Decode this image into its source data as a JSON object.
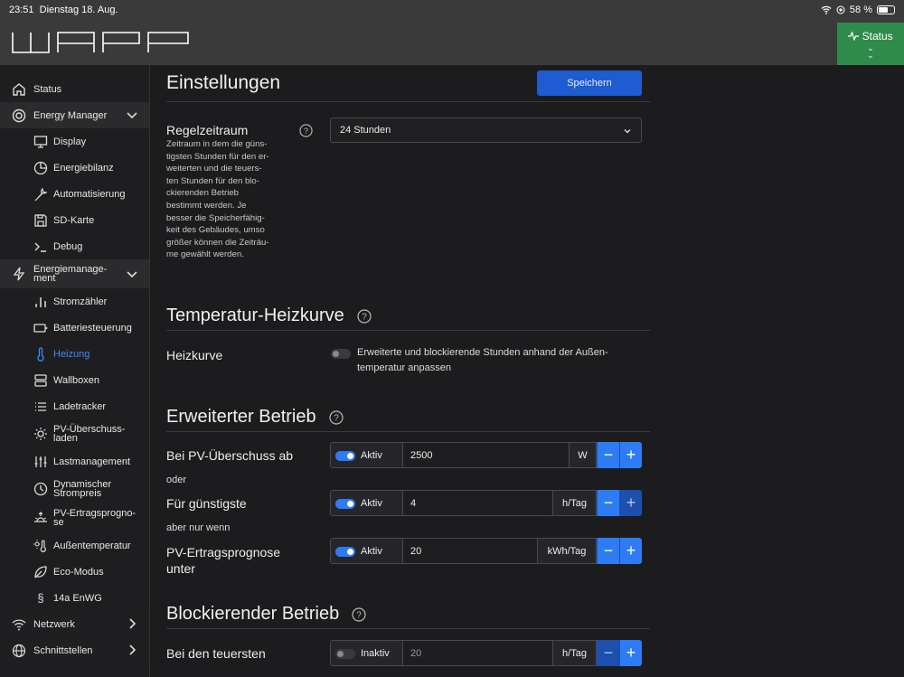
{
  "statusbar": {
    "time": "23:51",
    "date": "Dienstag 18. Aug.",
    "battery": "58 %"
  },
  "header": {
    "logo": "WARP",
    "status_label": "Status"
  },
  "sidebar": {
    "items": [
      {
        "label": "Status",
        "icon": "home-icon"
      },
      {
        "label": "Energy Manager",
        "icon": "energy-manager-icon"
      },
      {
        "label": "Display",
        "icon": "monitor-icon"
      },
      {
        "label": "Energiebilanz",
        "icon": "pie-chart-icon"
      },
      {
        "label": "Automatisierung",
        "icon": "wrench-icon"
      },
      {
        "label": "SD-Karte",
        "icon": "save-icon"
      },
      {
        "label": "Debug",
        "icon": "terminal-icon"
      },
      {
        "label": "Energiemanage-\nment",
        "icon": "lightning-icon"
      },
      {
        "label": "Stromzähler",
        "icon": "bar-chart-icon"
      },
      {
        "label": "Batteriesteuerung",
        "icon": "battery-icon"
      },
      {
        "label": "Heizung",
        "icon": "thermometer-icon"
      },
      {
        "label": "Wallboxen",
        "icon": "server-icon"
      },
      {
        "label": "Ladetracker",
        "icon": "list-icon"
      },
      {
        "label": "PV-Überschuss-\nladen",
        "icon": "sun-icon"
      },
      {
        "label": "Lastmanagement",
        "icon": "sliders-icon"
      },
      {
        "label": "Dynamischer\nStrompreis",
        "icon": "price-icon"
      },
      {
        "label": "PV-Ertragsprogno-\nse",
        "icon": "sunrise-icon"
      },
      {
        "label": "Außentemperatur",
        "icon": "temperature-sun-icon"
      },
      {
        "label": "Eco-Modus",
        "icon": "leaf-icon"
      },
      {
        "label": "14a EnWG",
        "icon": "paragraph-icon"
      },
      {
        "label": "Netzwerk",
        "icon": "wifi-icon"
      },
      {
        "label": "Schnittstellen",
        "icon": "globe-icon"
      }
    ]
  },
  "main": {
    "title": "Einstellungen",
    "save_label": "Speichern",
    "regelzeitraum": {
      "label": "Regelzeitraum",
      "description": "Zeitraum in dem die güns-\ntigsten Stunden für den er-\nweiterten und die teuers-\nten Stunden für den blo-\nckierenden Betrieb\nbestimmt werden. Je\nbesser die Speicherfähig-\nkeit des Gebäudes, umso\ngrößer können die Zeiträu-\nme gewählt werden.",
      "value": "24 Stunden"
    },
    "heizkurve": {
      "section_title": "Temperatur-Heizkurve",
      "label": "Heizkurve",
      "toggle_text": "Erweiterte und blockierende Stunden anhand der Außen-\ntemperatur anpassen",
      "enabled": false
    },
    "erweitert": {
      "section_title": "Erweiterter Betrieb",
      "pv_label": "Bei PV-Überschuss ab",
      "pv_state": "Aktiv",
      "pv_value": "2500",
      "pv_unit": "W",
      "oder": "oder",
      "cheap_label": "Für günstigste",
      "cheap_state": "Aktiv",
      "cheap_value": "4",
      "cheap_unit": "h/Tag",
      "aber": "aber nur wenn",
      "forecast_label": "PV-Ertragsprognose\nunter",
      "forecast_state": "Aktiv",
      "forecast_value": "20",
      "forecast_unit": "kWh/Tag"
    },
    "blockierend": {
      "section_title": "Blockierender Betrieb",
      "expensive_label": "Bei den teuersten",
      "expensive_state": "Inaktiv",
      "expensive_value": "20",
      "expensive_unit": "h/Tag"
    },
    "minus": "−",
    "plus": "+"
  },
  "colors": {
    "accent": "#2d7cf6",
    "status_green": "#2e8b4c",
    "active_nav": "#3d8bfd"
  }
}
